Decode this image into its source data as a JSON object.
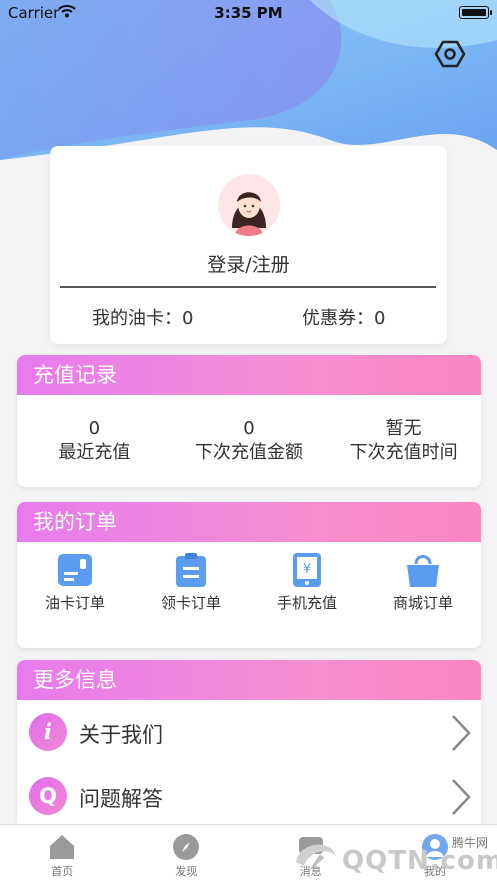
{
  "status_bar": {
    "carrier": "Carrier",
    "time": "3:35 PM",
    "battery_level": 1.0
  },
  "icons": {
    "wifi": "wifi-icon",
    "battery": "battery-icon",
    "settings": "hexagon-gear-icon",
    "avatar": "girl-avatar-icon",
    "orders": [
      "card-icon",
      "clipboard-icon",
      "phone-yen-icon",
      "shopping-bag-icon"
    ],
    "more": [
      "info-icon",
      "q-icon"
    ],
    "chevron": "chevron-right-icon",
    "tabs": [
      "home-icon",
      "compass-icon",
      "message-icon",
      "user-icon"
    ]
  },
  "colors": {
    "accent_pink": "#f58fd2",
    "accent_purple": "#e77bee",
    "order_icon_blue": "#5a9cf0",
    "hero_blue": "#7cc0f6"
  },
  "profile": {
    "login_label": "登录/注册",
    "oil_card": "我的油卡：0",
    "coupon": "优惠券：0"
  },
  "recharge": {
    "title": "充值记录",
    "stats": [
      {
        "value": "0",
        "label": "最近充值"
      },
      {
        "value": "0",
        "label": "下次充值金额"
      },
      {
        "value": "暂无",
        "label": "下次充值时间"
      }
    ]
  },
  "orders": {
    "title": "我的订单",
    "items": [
      {
        "label": "油卡订单"
      },
      {
        "label": "领卡订单"
      },
      {
        "label": "手机充值"
      },
      {
        "label": "商城订单"
      }
    ]
  },
  "more": {
    "title": "更多信息",
    "items": [
      {
        "glyph": "i",
        "label": "关于我们"
      },
      {
        "glyph": "Q",
        "label": "问题解答"
      }
    ]
  },
  "tabs": [
    {
      "label": "首页"
    },
    {
      "label": "发现"
    },
    {
      "label": "消息"
    },
    {
      "label": "我的"
    }
  ],
  "watermark": {
    "text": "QQTN.com",
    "tag": "腾牛网"
  }
}
